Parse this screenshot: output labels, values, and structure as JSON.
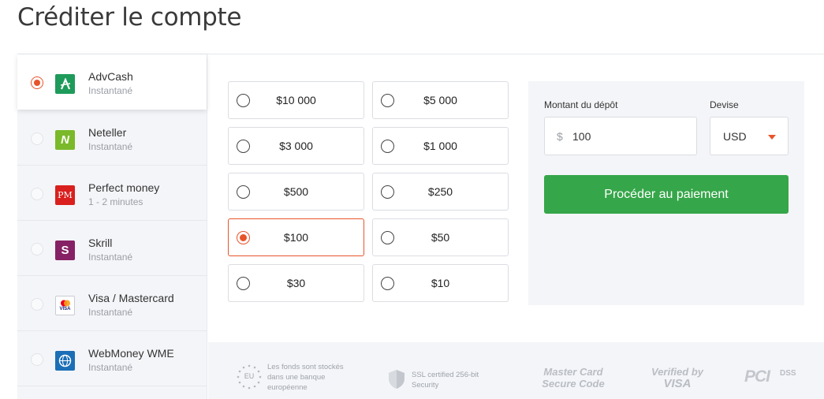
{
  "page": {
    "title": "Créditer le compte"
  },
  "methods": [
    {
      "name": "AdvCash",
      "sub": "Instantané",
      "icon": "advcash-icon",
      "selected": true
    },
    {
      "name": "Neteller",
      "sub": "Instantané",
      "icon": "neteller-icon",
      "selected": false
    },
    {
      "name": "Perfect money",
      "sub": "1 - 2 minutes",
      "icon": "perfect-money-icon",
      "selected": false
    },
    {
      "name": "Skrill",
      "sub": "Instantané",
      "icon": "skrill-icon",
      "selected": false
    },
    {
      "name": "Visa / Mastercard",
      "sub": "Instantané",
      "icon": "visa-mastercard-icon",
      "selected": false
    },
    {
      "name": "WebMoney WME",
      "sub": "Instantané",
      "icon": "webmoney-icon",
      "selected": false
    }
  ],
  "icons": {
    "advcash_glyph": "A",
    "neteller_glyph": "N",
    "perfect_money_glyph": "PM",
    "skrill_glyph": "S",
    "visa_glyph": "VISA",
    "webmoney_glyph": "W"
  },
  "amounts": [
    {
      "label": "$10 000",
      "selected": false
    },
    {
      "label": "$5 000",
      "selected": false
    },
    {
      "label": "$3 000",
      "selected": false
    },
    {
      "label": "$1 000",
      "selected": false
    },
    {
      "label": "$500",
      "selected": false
    },
    {
      "label": "$250",
      "selected": false
    },
    {
      "label": "$100",
      "selected": true
    },
    {
      "label": "$50",
      "selected": false
    },
    {
      "label": "$30",
      "selected": false
    },
    {
      "label": "$10",
      "selected": false
    }
  ],
  "deposit": {
    "amount_label": "Montant du dépôt",
    "currency_sign": "$",
    "amount_value": "100",
    "currency_label": "Devise",
    "currency_value": "USD",
    "submit_label": "Procéder au paiement"
  },
  "trust": {
    "eu_badge": "EU",
    "eu_text": "Les fonds sont stockés dans une banque européenne",
    "ssl_text": "SSL certified 256-bit Security",
    "mastercard_line1": "Master Card",
    "mastercard_line2": "Secure Code",
    "verified_line1": "Verified by",
    "verified_line2": "VISA",
    "pci_main": "PCI",
    "pci_sub": "DSS"
  },
  "colors": {
    "accent": "#e8542a",
    "primary_button": "#36a64a",
    "advcash": "#1e9b5a",
    "neteller": "#7ab929",
    "perfect_money": "#d9201e",
    "skrill": "#862165",
    "webmoney": "#1b6fb6"
  }
}
